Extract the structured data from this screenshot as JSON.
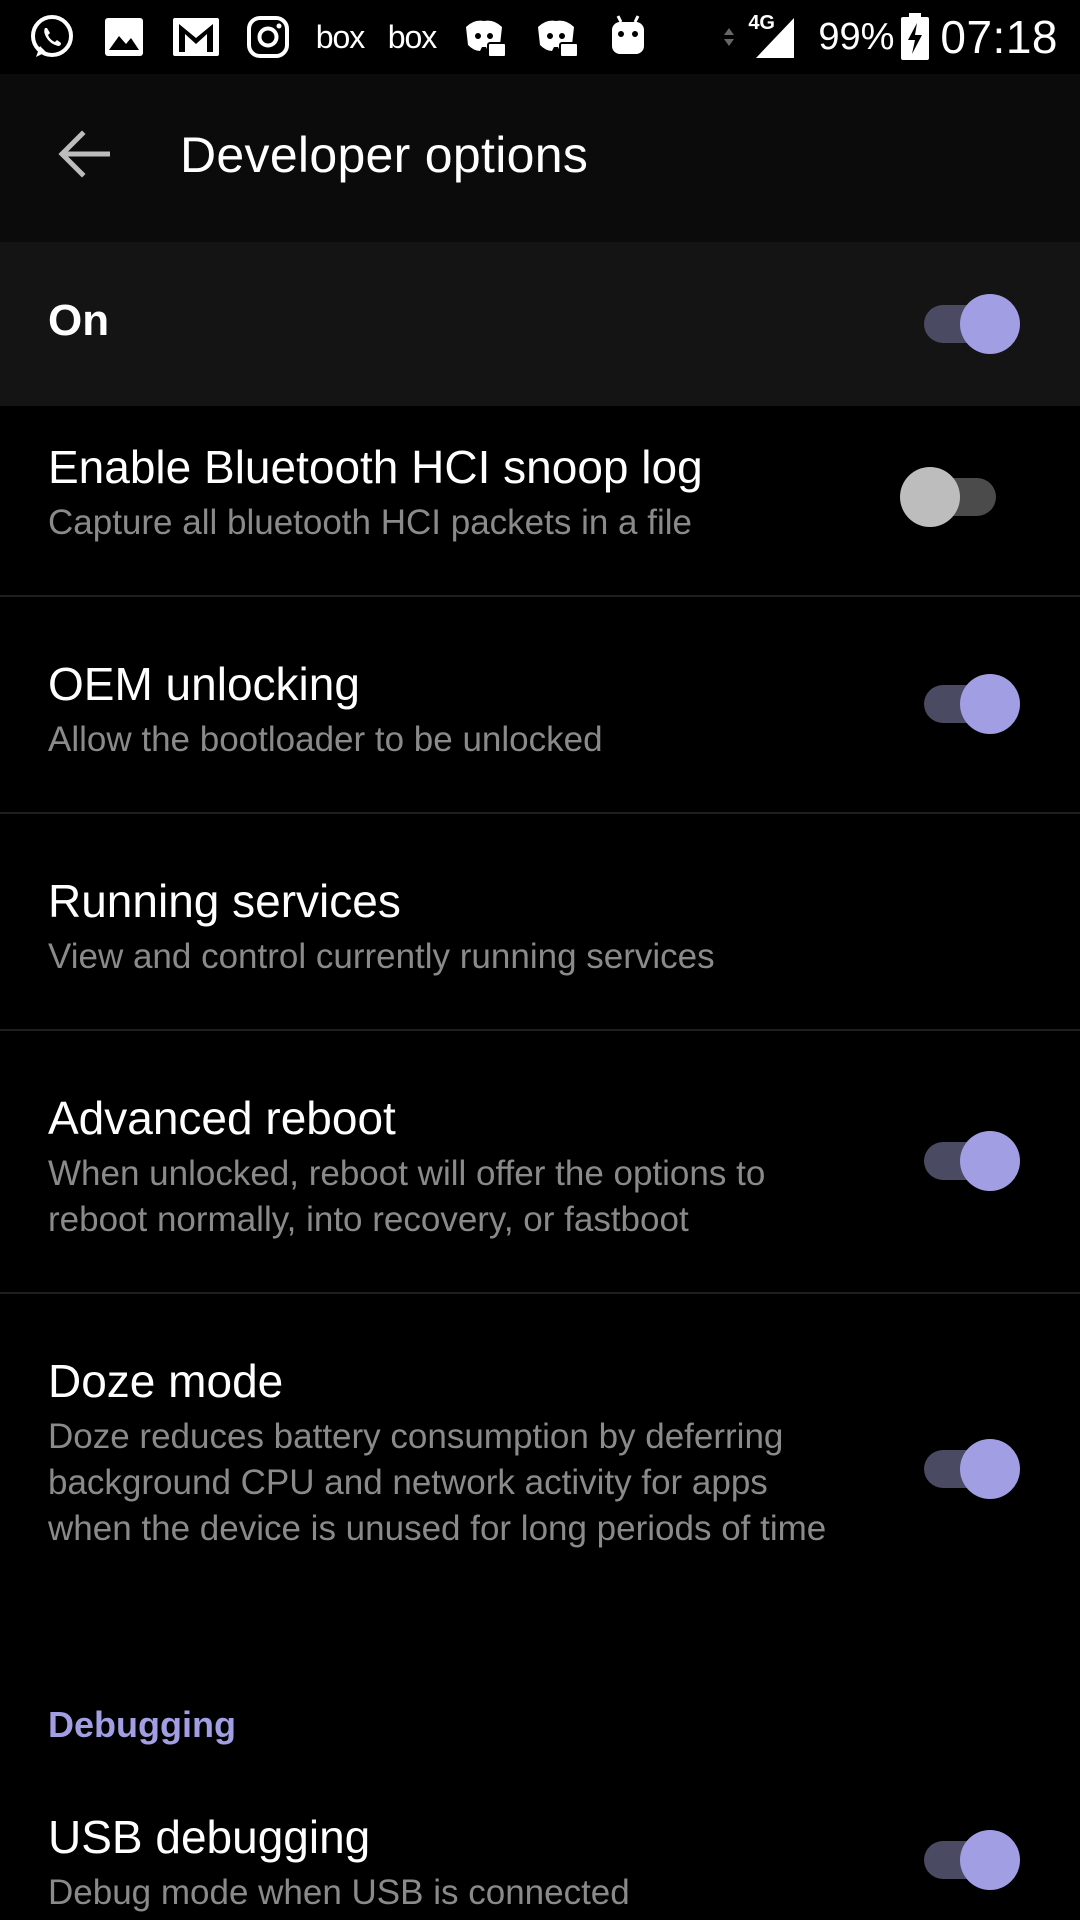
{
  "status_bar": {
    "notification_icons": [
      "whatsapp-icon",
      "gallery-icon",
      "gmail-icon",
      "instagram-icon",
      "box-icon",
      "box-icon",
      "discord-icon",
      "discord-icon",
      "android-icon"
    ],
    "box_label": "box",
    "network_type": "4G",
    "battery_percent": "99%",
    "time": "07:18"
  },
  "app_bar": {
    "title": "Developer options"
  },
  "master_switch": {
    "label": "On",
    "state": "on"
  },
  "settings": [
    {
      "title": "Enable Bluetooth HCI snoop log",
      "summary": "Capture all bluetooth HCI packets in a file",
      "toggle": "off"
    },
    {
      "title": "OEM unlocking",
      "summary": "Allow the bootloader to be unlocked",
      "toggle": "on"
    },
    {
      "title": "Running services",
      "summary": "View and control currently running services",
      "toggle": null
    },
    {
      "title": "Advanced reboot",
      "summary": "When unlocked, reboot will offer the options to reboot normally, into recovery, or fastboot",
      "toggle": "on"
    },
    {
      "title": "Doze mode",
      "summary": "Doze reduces battery consumption by deferring background CPU and network activity for apps when the device is unused for long periods of time",
      "toggle": "on"
    }
  ],
  "debugging_section": {
    "header": "Debugging",
    "items": [
      {
        "title": "USB debugging",
        "summary": "Debug mode when USB is connected",
        "toggle": "on"
      }
    ]
  },
  "colors": {
    "accent": "#a19ee3",
    "background": "#000000",
    "app_bar": "#0b0b0b",
    "master_row": "#141414",
    "summary_text": "#8a8a8a"
  }
}
